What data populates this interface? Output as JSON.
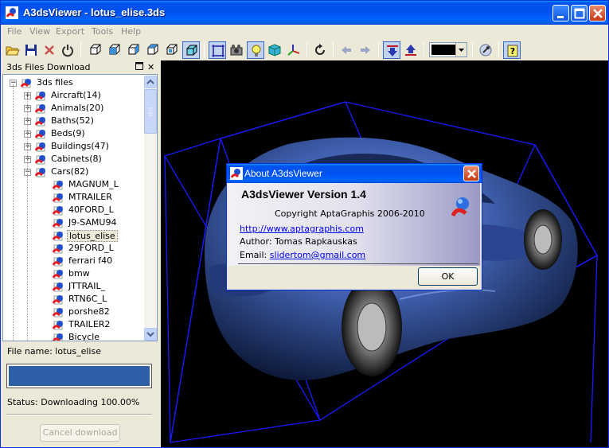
{
  "window": {
    "title": "A3dsViewer - lotus_elise.3ds"
  },
  "menu": [
    "File",
    "View",
    "Export",
    "Tools",
    "Help"
  ],
  "panel": {
    "title": "3ds Files Download",
    "close_glyph": "✕"
  },
  "tree": {
    "root": "3ds files",
    "categories": [
      "Aircraft(14)",
      "Animals(20)",
      "Baths(52)",
      "Beds(9)",
      "Buildings(47)",
      "Cabinets(8)",
      "Cars(82)"
    ],
    "cars": [
      "MAGNUM_L",
      "MTRAILER",
      "40FORD_L",
      "J9-SAMU94",
      "lotus_elise",
      "29FORD_L",
      "ferrari f40",
      "bmw",
      "JTTRAIL_",
      "RTN6C_L",
      "porshe82",
      "TRAILER2",
      "Bicycle"
    ],
    "selected": "lotus_elise"
  },
  "download": {
    "file_name": "File name: lotus_elise",
    "progress_percent": 100,
    "status": "Status: Downloading  100.00%",
    "cancel_label": "Cancel download"
  },
  "about": {
    "title": "About A3dsViewer",
    "version": "A3dsViewer Version 1.4",
    "copyright": "Copyright AptaGraphis 2006-2010",
    "url": "http://www.aptagraphis.com",
    "author": "Author: Tomas Rapkauskas",
    "email_label": "Email:",
    "email": "slidertom@gmail.com",
    "ok_label": "OK"
  },
  "colors": {
    "titlebar": "#0054e3",
    "background": "#ece9d8",
    "viewport": "#000000",
    "bbox": "#1a1aff",
    "car": "#3f5fae",
    "progress": "#2e5ea8"
  }
}
